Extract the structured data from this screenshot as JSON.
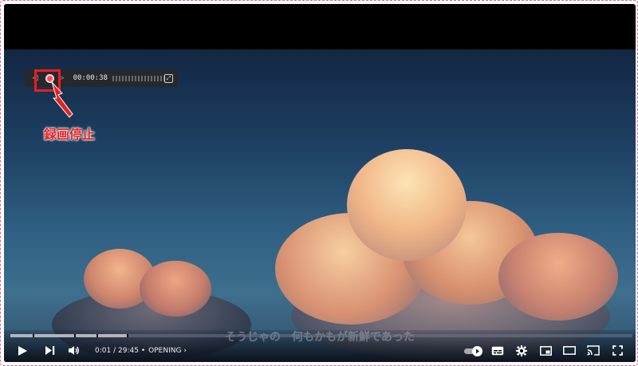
{
  "annotation": {
    "label": "録画停止"
  },
  "recorder": {
    "elapsed_time": "00:00:38"
  },
  "subtitle": {
    "text": "そうじゃの　何もかもが新鮮であった"
  },
  "player": {
    "current_time": "0:01",
    "separator": "/",
    "duration": "29:45",
    "bullet": "•",
    "chapter": "OPENING",
    "chapter_chevron": "›",
    "progress": 0.0
  },
  "icons": {
    "play": "play-icon",
    "next": "next-icon",
    "volume": "volume-icon",
    "autoplay": "autoplay-toggle-icon",
    "subtitles": "subtitles-icon",
    "settings": "gear-icon",
    "miniplayer": "miniplayer-icon",
    "theater": "theater-mode-icon",
    "cast": "cast-icon",
    "fullscreen": "fullscreen-icon"
  },
  "colors": {
    "annotation_red": "#e52222",
    "record_stop_red": "#ff4a5f"
  }
}
